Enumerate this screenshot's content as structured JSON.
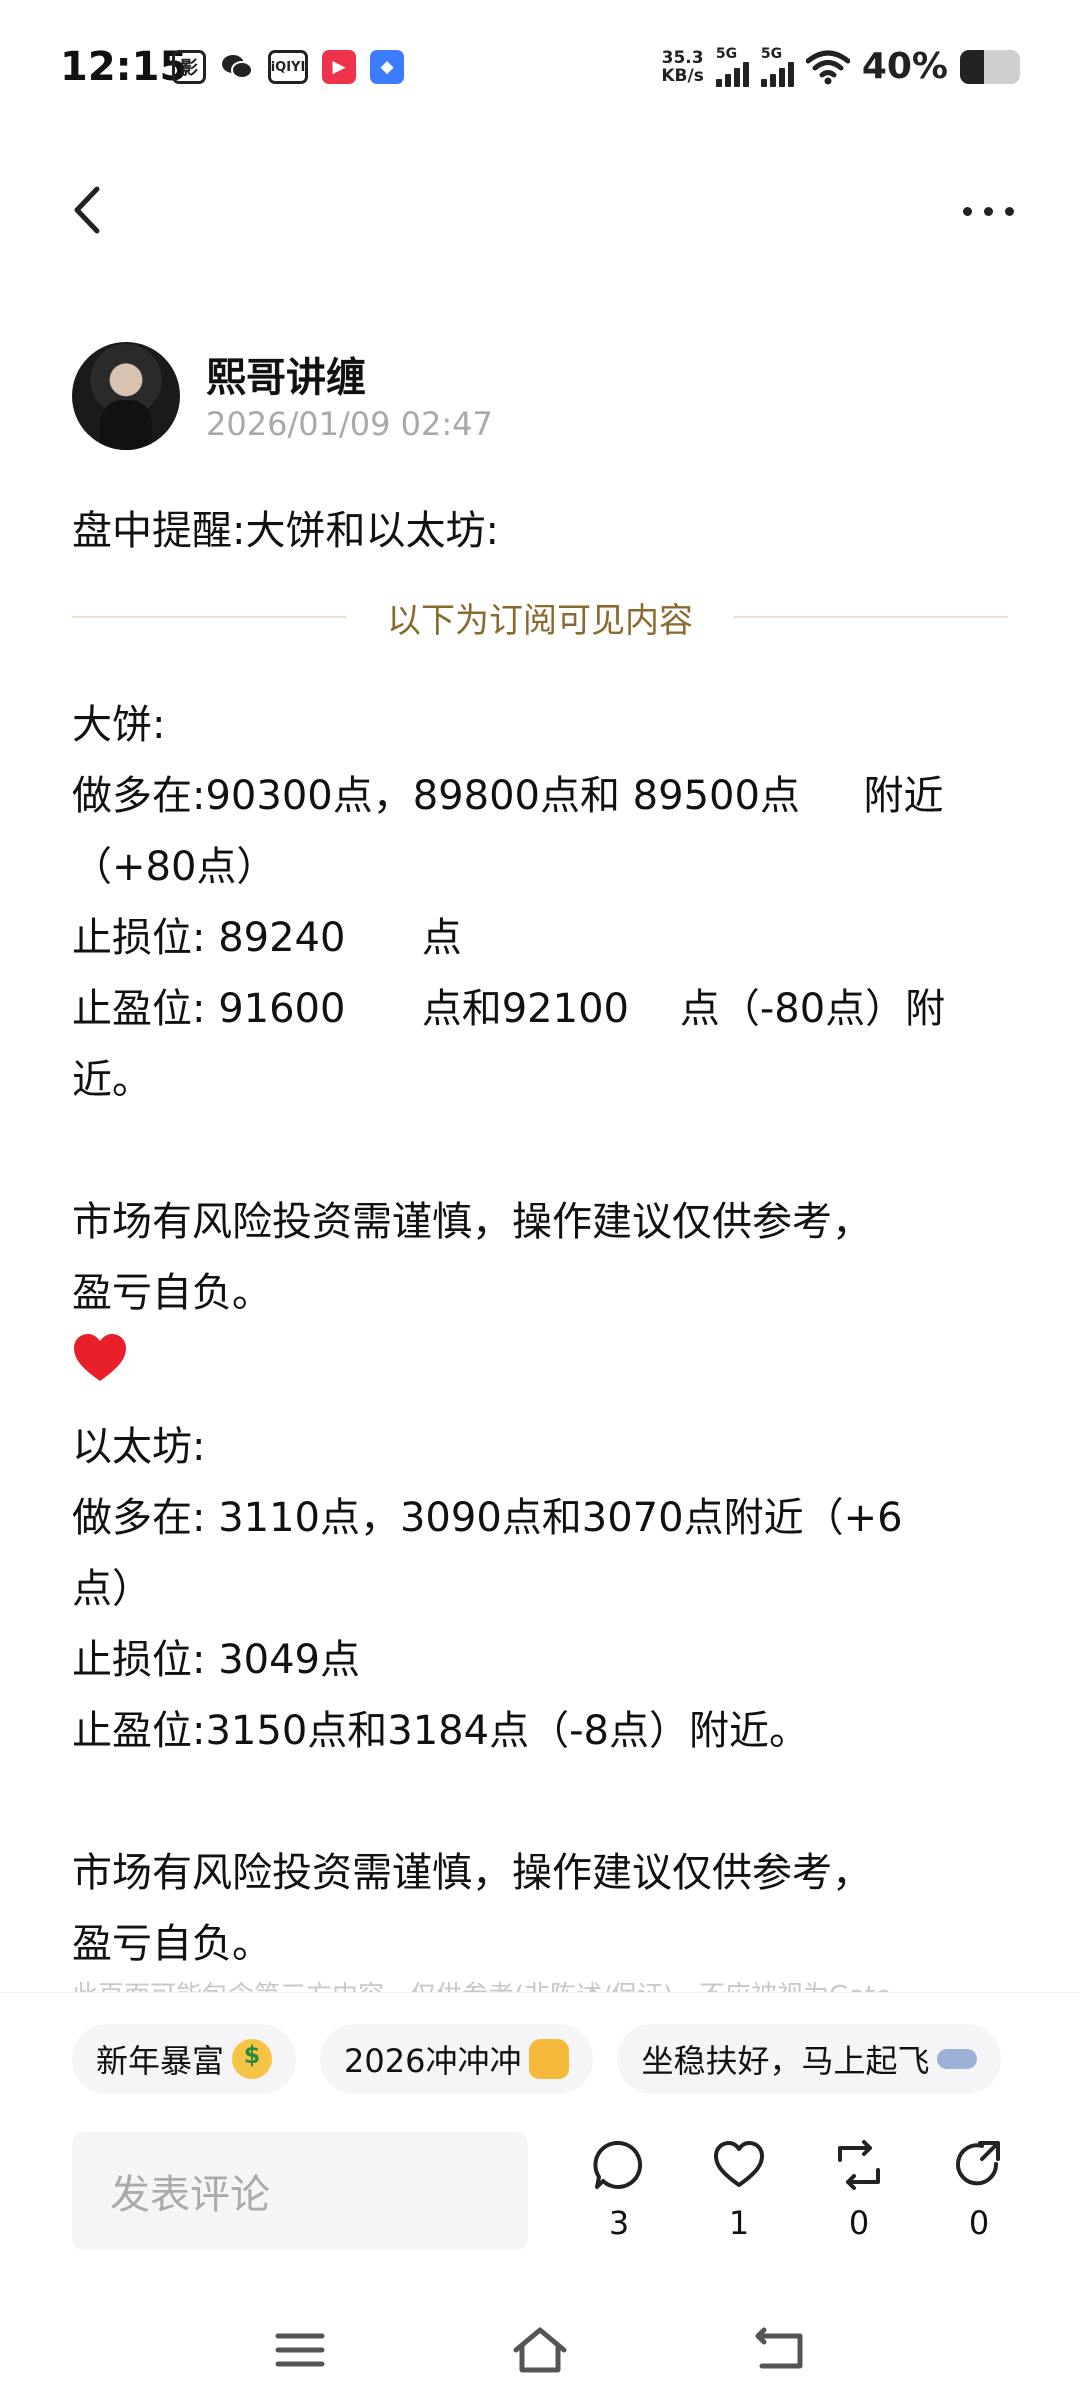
{
  "status_bar": {
    "time": "12:15",
    "apps": [
      "影",
      "wechat-icon",
      "iQIYI",
      "video-icon",
      "browser-icon"
    ],
    "net_speed_value": "35.3",
    "net_speed_unit": "KB/s",
    "sim1": "5G",
    "sim2": "5G",
    "battery_percent": "40%",
    "battery_level": 0.4
  },
  "author": {
    "name": "熙哥讲缠",
    "time": "2026/01/09 02:47"
  },
  "post": {
    "title": "盘中提醒:大饼和以太坊:",
    "divider": "以下为订阅可见内容",
    "lines": [
      "大饼:",
      "做多在:90300点，89800点和 89500点     附近",
      "（+80点）",
      "止损位: 89240      点",
      "止盈位: 91600      点和92100    点（-80点）附",
      "近。",
      "",
      "市场有风险投资需谨慎，操作建议仅供参考，",
      "盈亏自负。",
      "__HEART__",
      "以太坊:",
      "做多在: 3110点，3090点和3070点附近（+6",
      "点）",
      "止损位: 3049点",
      "止盈位:3150点和3184点（-8点）附近。",
      "",
      "市场有风险投资需谨慎，操作建议仅供参考，",
      "盈亏自负。"
    ],
    "disclaimer": "此页面可能包含第三方内容，仅供参考(非陈述/保证)，不应被视为Gate"
  },
  "tags": [
    {
      "label": "新年暴富",
      "emoji": "money-face-icon"
    },
    {
      "label": "2026冲冲冲",
      "emoji": "fist-icon"
    },
    {
      "label": "坐稳扶好，马上起飞",
      "emoji": "airplane-icon"
    }
  ],
  "comment_box": {
    "placeholder": "发表评论"
  },
  "actions": {
    "comment_count": "3",
    "like_count": "1",
    "repost_count": "0",
    "share_count": "0"
  },
  "colors": {
    "divider_text": "#8a6a2d",
    "muted": "#a9a9a9",
    "heart": "#e8202a"
  }
}
